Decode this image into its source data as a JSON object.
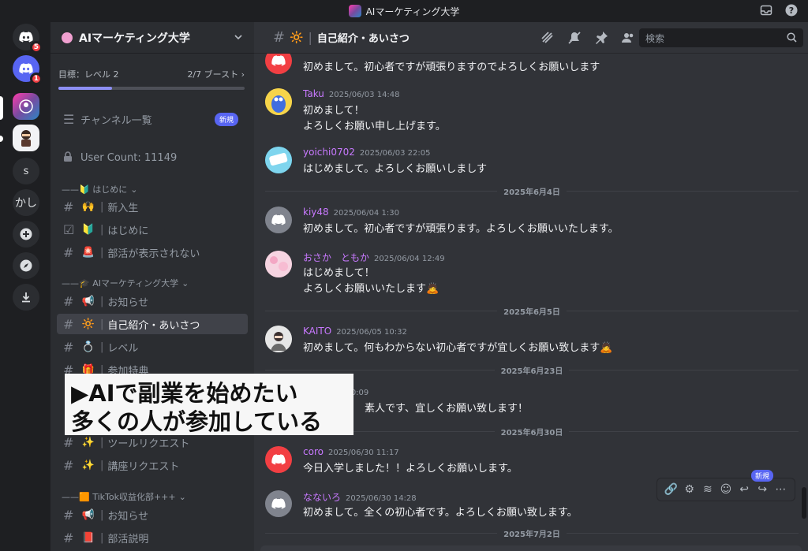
{
  "titlebar": {
    "title": "AIマーケティング大学"
  },
  "rail": {
    "servers": [
      {
        "name": "Discord",
        "badge": "5"
      },
      {
        "name": "Discord",
        "badge": "1"
      },
      {
        "name": "AIマーケティング大学"
      },
      {
        "name": "server"
      },
      {
        "label": "s"
      },
      {
        "label": "かし"
      }
    ]
  },
  "sidebar": {
    "guild_name": "AIマーケティング大学",
    "boost_goal": "目標：レベル 2",
    "boost_count": "2/7 ブースト",
    "boost_progress": 0.29,
    "channel_list": "チャンネル一覧",
    "new_label": "新規",
    "user_count": "User Count: 11149",
    "categories": [
      {
        "label": "——🔰 はじめに"
      },
      {
        "label": "——🎓 AIマーケティング大学"
      },
      {
        "label": "——🟧 TikTok収益化部+++"
      }
    ],
    "channels": [
      {
        "emoji": "🙌",
        "name": "新入生"
      },
      {
        "emoji": "🔰",
        "name": "はじめに"
      },
      {
        "emoji": "🚨",
        "name": "部活が表示されない"
      },
      {
        "emoji": "📢",
        "name": "お知らせ"
      },
      {
        "emoji": "🔆",
        "name": "自己紹介・あいさつ"
      },
      {
        "emoji": "💍",
        "name": "レベル"
      },
      {
        "emoji": "🎁",
        "name": "参加特典"
      },
      {
        "emoji": "✨",
        "name": "ツールリクエスト"
      },
      {
        "emoji": "✨",
        "name": "講座リクエスト"
      },
      {
        "emoji": "📢",
        "name": "お知らせ"
      },
      {
        "emoji": "📕",
        "name": "部活説明"
      }
    ]
  },
  "caption": {
    "line1": "▶AIで副業を始めたい",
    "line2": "多くの人が参加している"
  },
  "chat": {
    "channel_emoji": "🔆",
    "channel_name": "自己紹介・あいさつ",
    "search_placeholder": "検索",
    "messages": [
      {
        "user": "",
        "time": "",
        "lines": [
          "初めまして。初心者ですが頑張りますのでよろしくお願いします"
        ]
      },
      {
        "user": "Taku",
        "time": "2025/06/03 14:48",
        "lines": [
          "初めまして！",
          "よろしくお願い申し上げます。"
        ]
      },
      {
        "user": "yoichi0702",
        "time": "2025/06/03 22:05",
        "lines": [
          "はじめまして。よろしくお願いしましす"
        ]
      },
      {
        "user": "kiy48",
        "time": "2025/06/04 1:30",
        "lines": [
          "初めまして。初心者ですが頑張ります。よろしくお願いいたします。"
        ]
      },
      {
        "user": "おさか　ともか",
        "time": "2025/06/04 12:49",
        "lines": [
          "はじめまして！",
          "よろしくお願いいたします🙇"
        ]
      },
      {
        "user": "KAITO",
        "time": "2025/06/05 10:32",
        "lines": [
          "初めまして。何もわからない初心者ですが宜しくお願い致します🙇"
        ]
      },
      {
        "user": "",
        "time": "2025/06/23 0:09",
        "lines": [
          "素人です、宜しくお願い致します！"
        ]
      },
      {
        "user": "coro",
        "time": "2025/06/30 11:17",
        "lines": [
          "今日入学しました！！よろしくお願いします。"
        ]
      },
      {
        "user": "なないろ",
        "time": "2025/06/30 14:28",
        "lines": [
          "初めまして。全くの初心者です。よろしくお願い致します。"
        ]
      }
    ],
    "dates": [
      "2025年6月4日",
      "2025年6月5日",
      "2025年6月23日",
      "2025年6月30日",
      "2025年7月2日"
    ],
    "hover_new": "新規"
  }
}
